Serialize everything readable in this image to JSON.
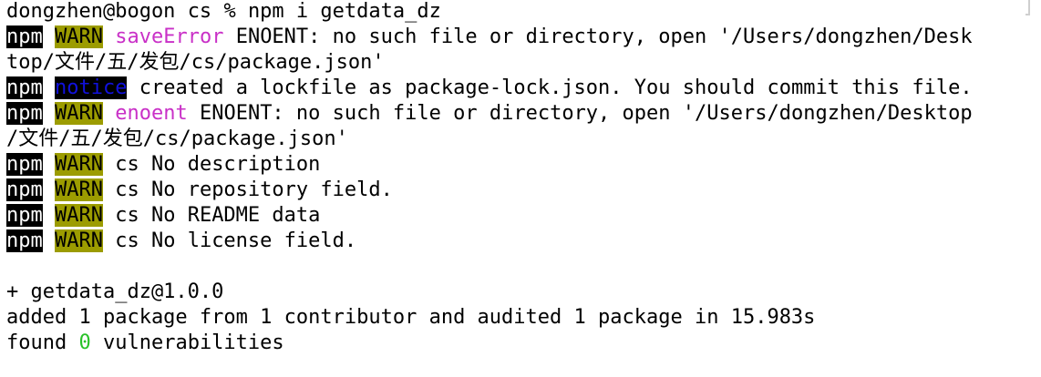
{
  "terminal": {
    "prompt_user": "dongzhen@bogon",
    "prompt_dir": "cs",
    "prompt_symbol": "%",
    "command": "npm i getdata_dz",
    "npm_tag": "npm",
    "warn_tag": "WARN",
    "notice_tag": "notice",
    "save_error_label": "saveError",
    "save_error_msg_1": " ENOENT: no such file or directory, open '/Users/dongzhen/Desk",
    "save_error_msg_2": "top/文件/五/发包/cs/package.json'",
    "notice_msg": " created a lockfile as package-lock.json. You should commit this file.",
    "enoent_label": "enoent",
    "enoent_msg_1": " ENOENT: no such file or directory, open '/Users/dongzhen/Desktop",
    "enoent_msg_2": "/文件/五/发包/cs/package.json'",
    "warn_desc": " cs No description",
    "warn_repo": " cs No repository field.",
    "warn_readme": " cs No README data",
    "warn_license": " cs No license field.",
    "installed": "+ getdata_dz@1.0.0",
    "summary": "added 1 package from 1 contributor and audited 1 package in 15.983s",
    "found_prefix": "found ",
    "vuln_count": "0",
    "found_suffix": " vulnerabilities"
  },
  "colors": {
    "warn_bg": "#9c9c00",
    "notice_fg": "#1111dd",
    "label_magenta": "#c930c7",
    "count_green": "#28c228"
  }
}
